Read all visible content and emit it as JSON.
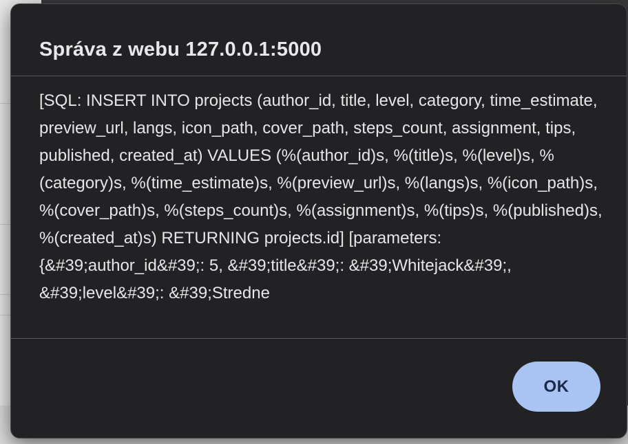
{
  "dialog": {
    "title": "Správa z webu 127.0.0.1:5000",
    "message": "[SQL: INSERT INTO projects (author_id, title, level, category, time_estimate, preview_url, langs, icon_path, cover_path, steps_count, assignment, tips, published, created_at) VALUES (%(author_id)s, %(title)s, %(level)s, %(category)s, %(time_estimate)s, %(preview_url)s, %(langs)s, %(icon_path)s, %(cover_path)s, %(steps_count)s, %(assignment)s, %(tips)s, %(published)s, %(created_at)s) RETURNING projects.id] [parameters: {&#39;author_id&#39;: 5, &#39;title&#39;: &#39;Whitejack&#39;, &#39;level&#39;: &#39;Stredne",
    "ok_label": "OK"
  },
  "colors": {
    "dialog_background": "#222224",
    "button_background": "#a9c4f2",
    "button_text": "#1a2a4a",
    "text": "#e6e6e8"
  }
}
